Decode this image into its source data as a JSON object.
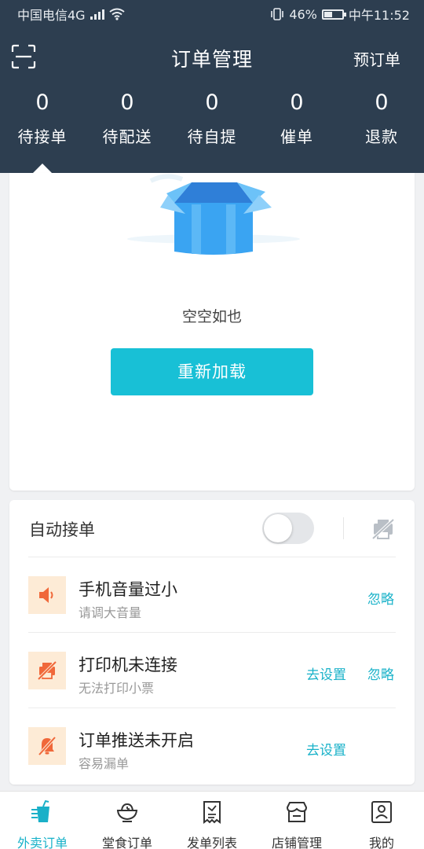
{
  "status_bar": {
    "carrier": "中国电信4G",
    "network_sup": "4G",
    "battery": "46%",
    "battery_level": 0.46,
    "time": "中午11:52"
  },
  "header": {
    "title": "订单管理",
    "right_action": "预订单",
    "stats": [
      {
        "count": "0",
        "label": "待接单"
      },
      {
        "count": "0",
        "label": "待配送"
      },
      {
        "count": "0",
        "label": "待自提"
      },
      {
        "count": "0",
        "label": "催单"
      },
      {
        "count": "0",
        "label": "退款"
      }
    ],
    "selected_tab_index": 0
  },
  "empty_state": {
    "message": "空空如也",
    "reload_label": "重新加载"
  },
  "settings": {
    "auto_accept_label": "自动接单",
    "auto_accept_on": false,
    "alerts": [
      {
        "title": "手机音量过小",
        "subtitle": "请调大音量",
        "icon": "speaker-icon",
        "actions": [
          "忽略"
        ]
      },
      {
        "title": "打印机未连接",
        "subtitle": "无法打印小票",
        "icon": "printer-off-icon",
        "actions": [
          "去设置",
          "忽略"
        ]
      },
      {
        "title": "订单推送未开启",
        "subtitle": "容易漏单",
        "icon": "bell-off-icon",
        "actions": [
          "去设置"
        ]
      }
    ]
  },
  "tabbar": {
    "items": [
      {
        "label": "外卖订单",
        "icon": "drink-icon",
        "active": true
      },
      {
        "label": "堂食订单",
        "icon": "bowl-icon",
        "active": false
      },
      {
        "label": "发单列表",
        "icon": "receipt-icon",
        "active": false
      },
      {
        "label": "店铺管理",
        "icon": "store-icon",
        "active": false
      },
      {
        "label": "我的",
        "icon": "profile-icon",
        "active": false
      }
    ]
  },
  "colors": {
    "header_bg": "#2d3e50",
    "accent": "#19b2c9",
    "button": "#18c0d6",
    "alert_icon": "#f0683a",
    "alert_icon_bg": "#fdebd6"
  }
}
